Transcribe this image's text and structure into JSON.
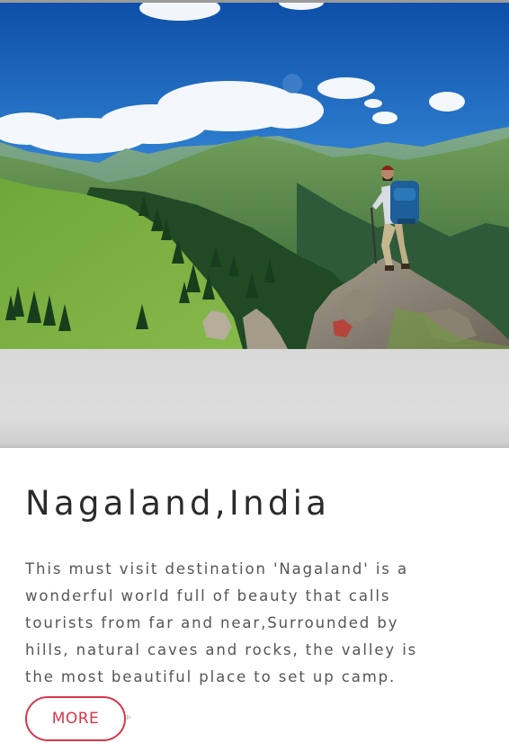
{
  "hero": {
    "image": "photo of a hiker with a blue backpack standing on a rocky outcrop overlooking green mountain valleys with pine forests under a blue sky with white clouds"
  },
  "card": {
    "title": "Nagaland,India",
    "description_lines": [
      "This must visit destination 'Nagaland' is a",
      "wonderful world full of beauty that calls",
      "tourists from far and near,Surrounded by",
      "hills, natural caves and rocks, the valley is",
      "the most beautiful place to set up camp."
    ],
    "more_label": "MORE",
    "arrow_glyph": "▹"
  },
  "colors": {
    "accent": "#d6374a",
    "title_text": "#2b2b2b",
    "body_text": "#555555",
    "band": "#dcdcdc"
  }
}
